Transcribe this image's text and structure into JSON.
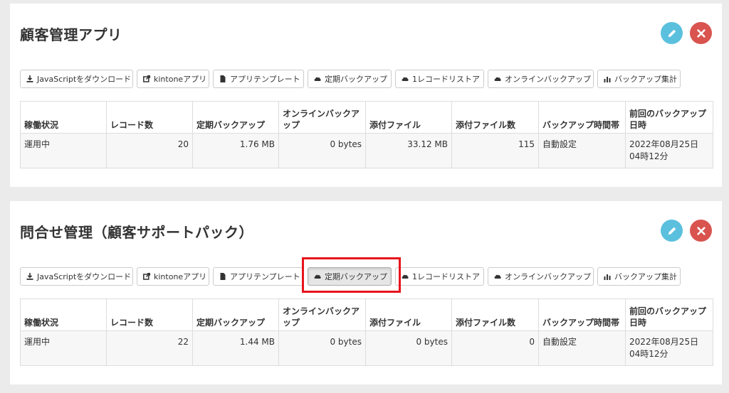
{
  "apps": [
    {
      "title": "顧客管理アプリ",
      "toolbar": [
        {
          "label": "JavaScriptをダウンロード",
          "icon": "download-icon",
          "width": 159
        },
        {
          "label": "kintoneアプリ",
          "icon": "external-link-icon",
          "width": 102
        },
        {
          "label": "アプリテンプレート",
          "icon": "file-icon",
          "width": 128
        },
        {
          "label": "定期バックアップ",
          "icon": "cloud-icon",
          "width": 118
        },
        {
          "label": "1レコードリストア",
          "icon": "cloud-icon",
          "width": 125
        },
        {
          "label": "オンラインバックアップ",
          "icon": "cloud-icon",
          "width": 149
        },
        {
          "label": "バックアップ集計",
          "icon": "bar-chart-icon",
          "width": 117
        }
      ],
      "columns": [
        "稼働状況",
        "レコード数",
        "定期バックアップ",
        "オンラインバックアップ",
        "添付ファイル",
        "添付ファイル数",
        "バックアップ時間帯",
        "前回のバックアップ日時"
      ],
      "row": [
        "運用中",
        "20",
        "1.76 MB",
        "0 bytes",
        "33.12 MB",
        "115",
        "自動設定",
        "2022年08月25日 04時12分"
      ]
    },
    {
      "title": "問合せ管理（顧客サポートパック）",
      "toolbar": [
        {
          "label": "JavaScriptをダウンロード",
          "icon": "download-icon",
          "width": 159
        },
        {
          "label": "kintoneアプリ",
          "icon": "external-link-icon",
          "width": 102
        },
        {
          "label": "アプリテンプレート",
          "icon": "file-icon",
          "width": 128
        },
        {
          "label": "定期バックアップ",
          "icon": "cloud-icon",
          "width": 118,
          "active": true
        },
        {
          "label": "1レコードリストア",
          "icon": "cloud-icon",
          "width": 125
        },
        {
          "label": "オンラインバックアップ",
          "icon": "cloud-icon",
          "width": 149
        },
        {
          "label": "バックアップ集計",
          "icon": "bar-chart-icon",
          "width": 117
        }
      ],
      "columns": [
        "稼働状況",
        "レコード数",
        "定期バックアップ",
        "オンラインバックアップ",
        "添付ファイル",
        "添付ファイル数",
        "バックアップ時間帯",
        "前回のバックアップ日時"
      ],
      "row": [
        "運用中",
        "22",
        "1.44 MB",
        "0 bytes",
        "0 bytes",
        "0",
        "自動設定",
        "2022年08月25日 04時12分"
      ]
    }
  ],
  "colors": {
    "edit": "#5bc0de",
    "delete": "#d9534f",
    "highlight": "#e8141c"
  }
}
